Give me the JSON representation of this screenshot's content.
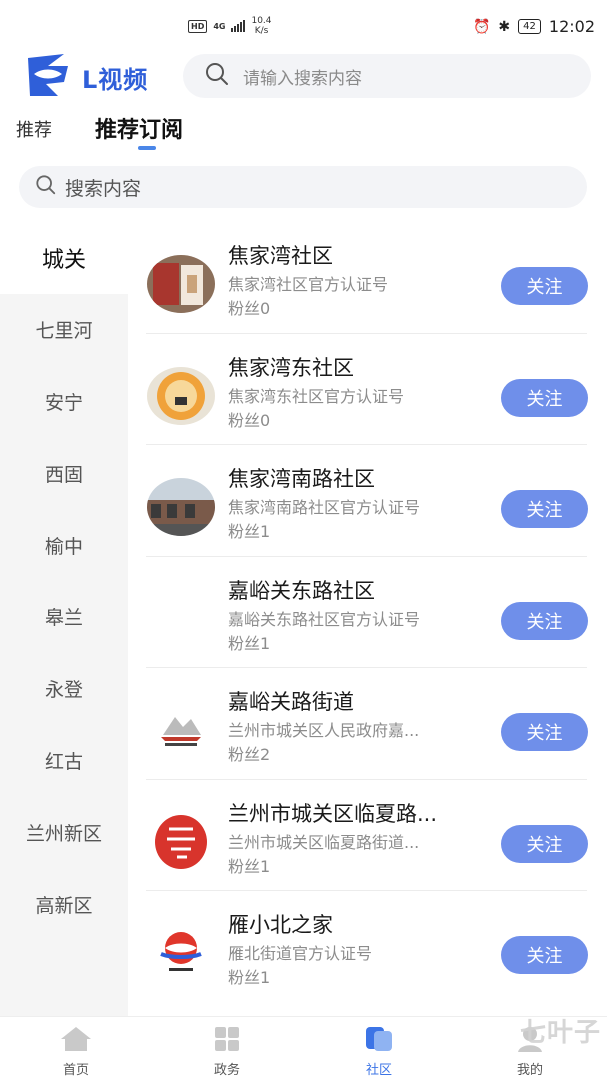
{
  "status_bar": {
    "hd": "HD",
    "network": "4G",
    "speed_value": "10.4",
    "speed_unit": "K/s",
    "battery": "42",
    "time": "12:02"
  },
  "header": {
    "app_name": "L视频",
    "search_placeholder": "请输入搜索内容"
  },
  "tabs": [
    {
      "label": "推荐",
      "active": false
    },
    {
      "label": "推荐订阅",
      "active": true
    }
  ],
  "sub_search": {
    "placeholder": "搜索内容"
  },
  "sidebar": {
    "items": [
      "城关",
      "七里河",
      "安宁",
      "西固",
      "榆中",
      "皋兰",
      "永登",
      "红古",
      "兰州新区",
      "高新区"
    ],
    "active_index": 0
  },
  "list": [
    {
      "title": "焦家湾社区",
      "desc": "焦家湾社区官方认证号",
      "fans": "粉丝0",
      "button": "关注"
    },
    {
      "title": "焦家湾东社区",
      "desc": "焦家湾东社区官方认证号",
      "fans": "粉丝0",
      "button": "关注"
    },
    {
      "title": "焦家湾南路社区",
      "desc": "焦家湾南路社区官方认证号",
      "fans": "粉丝1",
      "button": "关注"
    },
    {
      "title": "嘉峪关东路社区",
      "desc": "嘉峪关东路社区官方认证号",
      "fans": "粉丝1",
      "button": "关注"
    },
    {
      "title": "嘉峪关路街道",
      "desc": "兰州市城关区人民政府嘉...",
      "fans": "粉丝2",
      "button": "关注"
    },
    {
      "title": "兰州市城关区临夏路...",
      "desc": "兰州市城关区临夏路街道...",
      "fans": "粉丝1",
      "button": "关注"
    },
    {
      "title": "雁小北之家",
      "desc": "雁北街道官方认证号",
      "fans": "粉丝1",
      "button": "关注"
    }
  ],
  "bottom_nav": [
    {
      "label": "首页",
      "icon": "home-icon"
    },
    {
      "label": "政务",
      "icon": "grid-icon"
    },
    {
      "label": "社区",
      "icon": "community-icon",
      "active": true
    },
    {
      "label": "我的",
      "icon": "user-icon"
    }
  ],
  "watermark": "七叶子",
  "colors": {
    "brand": "#2f5fd9",
    "follow_button": "#6f8fea",
    "active_tab_indicator": "#4a86e8"
  }
}
